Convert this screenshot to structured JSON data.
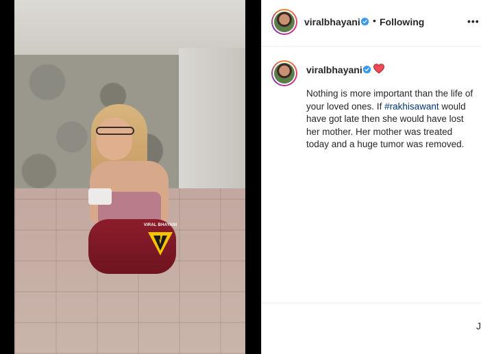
{
  "post": {
    "author": "viralbhayani",
    "follow_separator": "•",
    "follow_status": "Following",
    "more_options": "•••"
  },
  "media": {
    "watermark_text": "VIRAL BHAYANI"
  },
  "caption": {
    "author": "viralbhayani",
    "text_before": "Nothing is more important than the life of your loved ones. If ",
    "hashtag": "#rakhisawant",
    "text_after": " would have got late then she would have lost her mother. Her mother was treated today and a huge tumor was removed."
  },
  "footer": {
    "partial_glyph": "J"
  },
  "colors": {
    "verified_badge": "#3897f0",
    "hashtag_link": "#00376b",
    "heart": "#ed4956"
  },
  "icons": {
    "verified": "verified-badge-icon",
    "heart": "red-heart-icon",
    "more": "more-options-icon"
  }
}
